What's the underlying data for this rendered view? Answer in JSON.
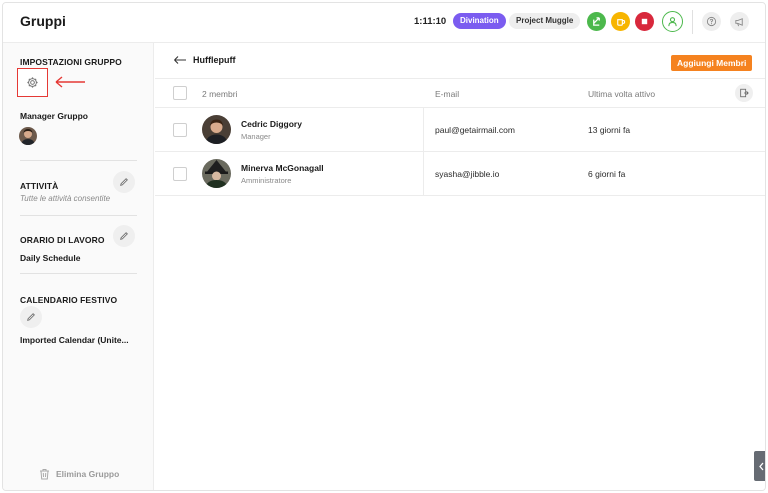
{
  "header": {
    "title": "Gruppi",
    "timer": "1:11:10",
    "activity_pill": "Divination",
    "project_pill": "Project Muggle",
    "colors": {
      "activity": "#7b5cf0",
      "green": "#4cb84c",
      "yellow": "#f7b500",
      "red": "#d8283c"
    }
  },
  "sidebar": {
    "settings_heading": "IMPOSTAZIONI GRUPPO",
    "manager_heading": "Manager Gruppo",
    "activities_heading": "ATTIVITÀ",
    "activities_value": "Tutte le attività consentite",
    "schedule_heading": "ORARIO DI LAVORO",
    "schedule_value": "Daily Schedule",
    "holiday_heading": "CALENDARIO FESTIVO",
    "holiday_value": "Imported Calendar (Unite...",
    "delete_label": "Elimina Gruppo"
  },
  "main": {
    "group_name": "Hufflepuff",
    "add_members_label": "Aggiungi Membri",
    "accent": "#f5821f",
    "columns": {
      "members": "2 membri",
      "email": "E-mail",
      "last_active": "Ultima volta attivo"
    },
    "rows": [
      {
        "name": "Cedric Diggory",
        "role": "Manager",
        "email": "paul@getairmail.com",
        "last_active": "13 giorni fa"
      },
      {
        "name": "Minerva McGonagall",
        "role": "Amministratore",
        "email": "syasha@jibble.io",
        "last_active": "6 giorni fa"
      }
    ]
  }
}
